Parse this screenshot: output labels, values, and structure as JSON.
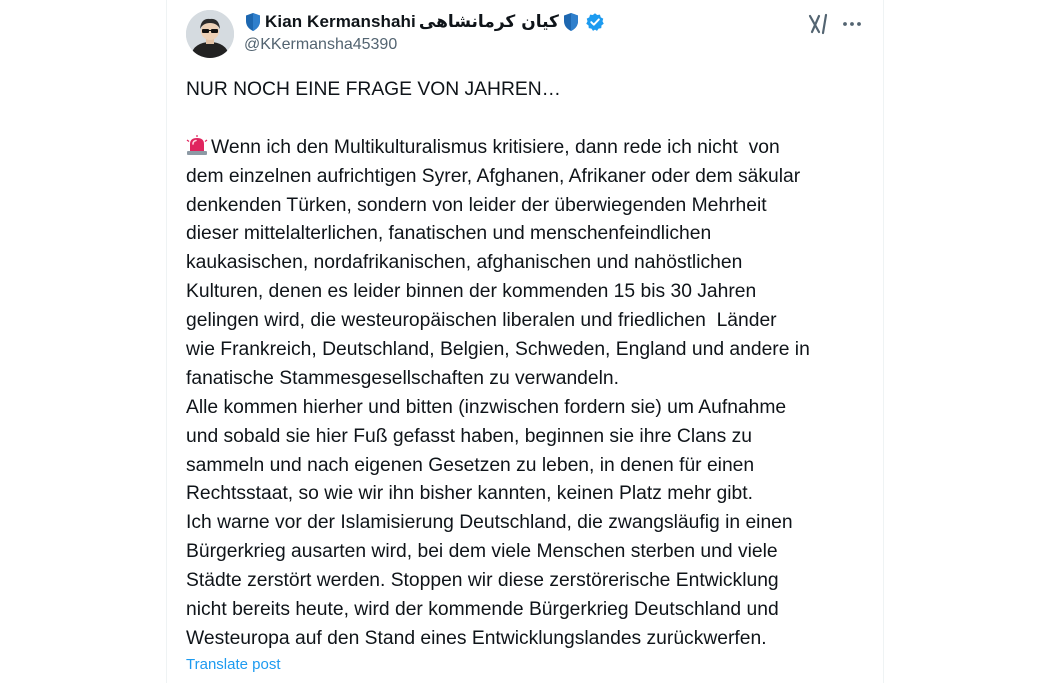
{
  "author": {
    "display_name": "Kian Kermanshahi",
    "display_name_fa": "کیان کرمانشاهی",
    "handle": "@KKermansha45390",
    "verified": true,
    "shield_color": "#1d67b0",
    "verified_color": "#1d9bf0"
  },
  "header_icons": [
    "shield-icon",
    "verified-icon",
    "grok-icon",
    "more-icon"
  ],
  "post": {
    "headline": "NUR NOCH EINE FRAGE VON JAHREN…",
    "lead_icon": "police-light-icon",
    "lines": [
      "Wenn ich den Multikulturalismus kritisiere, dann rede ich nicht  von",
      "dem einzelnen aufrichtigen Syrer, Afghanen, Afrikaner oder dem säkular",
      "denkenden Türken, sondern von leider der überwiegenden Mehrheit",
      "dieser mittelalterlichen, fanatischen und menschenfeindlichen",
      "kaukasischen, nordafrikanischen, afghanischen und nahöstlichen",
      "Kulturen, denen es leider binnen der kommenden 15 bis 30 Jahren",
      "gelingen wird, die westeuropäischen liberalen und friedlichen  Länder",
      "wie Frankreich, Deutschland, Belgien, Schweden, England und andere in",
      "fanatische Stammesgesellschaften zu verwandeln.",
      "Alle kommen hierher und bitten (inzwischen fordern sie) um Aufnahme",
      "und sobald sie hier Fuß gefasst haben, beginnen sie ihre Clans zu",
      "sammeln und nach eigenen Gesetzen zu leben, in denen für einen",
      "Rechtsstaat, so wie wir ihn bisher kannten, keinen Platz mehr gibt.",
      "Ich warne vor der Islamisierung Deutschland, die zwangsläufig in einen",
      "Bürgerkrieg ausarten wird, bei dem viele Menschen sterben und viele",
      "Städte zerstört werden. Stoppen wir diese zerstörerische Entwicklung",
      "nicht bereits heute, wird der kommende Bürgerkrieg Deutschland und",
      "Westeuropa auf den Stand eines Entwicklungslandes zurückwerfen."
    ],
    "translate_label": "Translate post",
    "text_color": "#0f1419",
    "link_color": "#1d9bf0"
  }
}
